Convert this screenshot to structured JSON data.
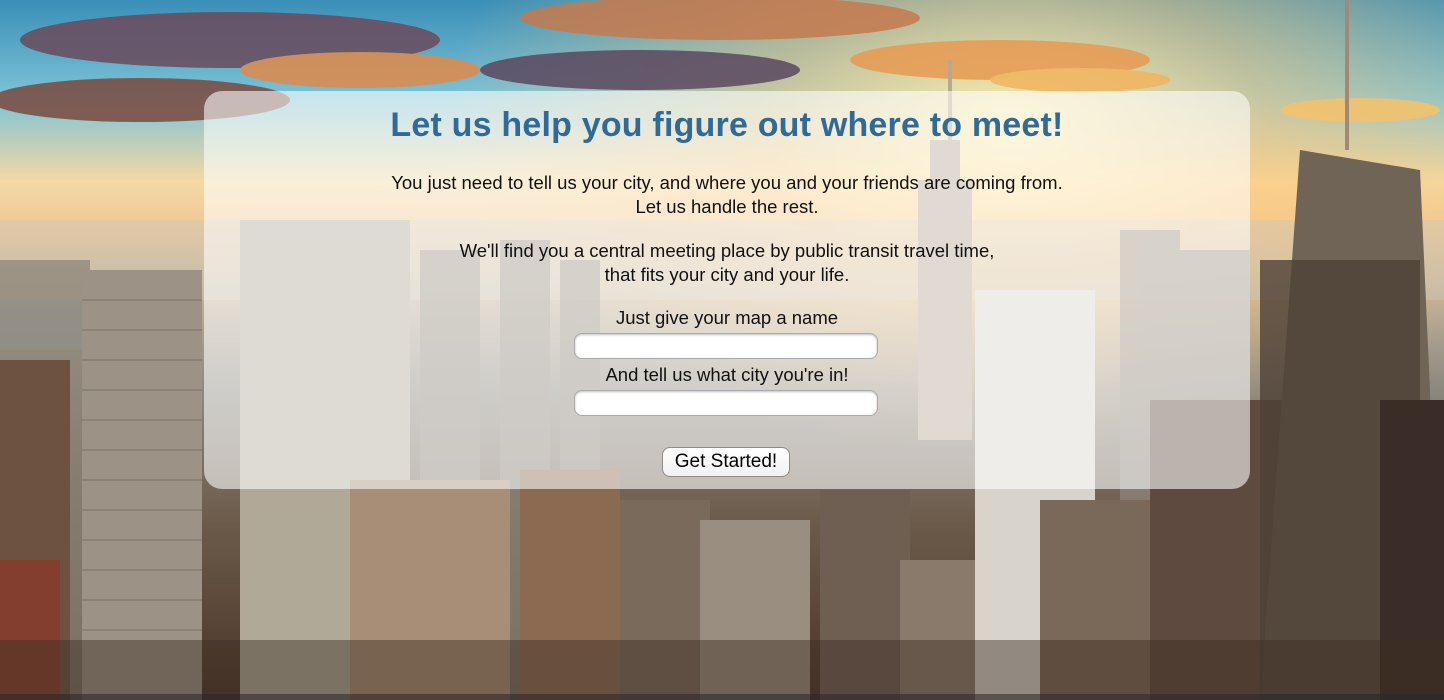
{
  "page": {
    "headline": "Let us help you figure out where to meet!",
    "intro_line_1": "You just need to tell us your city, and where you and your friends are coming from.",
    "intro_line_2": "Let us handle the rest.",
    "detail_line_1": "We'll find you a central meeting place by public transit travel time,",
    "detail_line_2": "that fits your city and your life."
  },
  "form": {
    "map_name_label": "Just give your map a name",
    "map_name_value": "",
    "city_label": "And tell us what city you're in!",
    "city_value": "",
    "submit_label": "Get Started!"
  },
  "colors": {
    "headline": "#2f6a98",
    "panel": "rgba(255,255,255,0.58)"
  },
  "background": {
    "icon": "city-skyline-photo"
  }
}
